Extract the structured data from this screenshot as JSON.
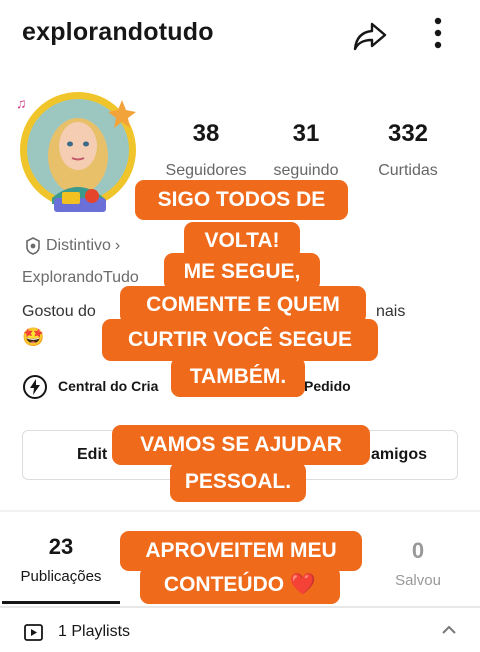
{
  "header": {
    "username": "explorandotudo"
  },
  "stats": [
    {
      "value": "38",
      "label": "Seguidores"
    },
    {
      "value": "31",
      "label": "seguindo"
    },
    {
      "value": "332",
      "label": "Curtidas"
    }
  ],
  "profile": {
    "badge_label": "Distintivo",
    "display_name": "ExplorandoTudo",
    "bio_start": "Gostou do",
    "bio_end": "nais",
    "bio_emoji": "🤩",
    "creator_center": "Central do Cria",
    "request_label": "Pedido"
  },
  "buttons": {
    "edit": "Edit",
    "friends": "amigos"
  },
  "overlay": {
    "line1": "SIGO TODOS DE",
    "line2": "VOLTA!",
    "line3": "ME SEGUE,",
    "line4": "COMENTE E QUEM",
    "line5": "CURTIR VOCÊ SEGUE",
    "line6": "TAMBÉM.",
    "line7": "VAMOS SE AJUDAR",
    "line8": "PESSOAL.",
    "line9": "APROVEITEM MEU",
    "line10": "CONTEÚDO ❤️"
  },
  "tabs": [
    {
      "value": "23",
      "label": "Publicações",
      "active": true
    },
    {
      "value": "0",
      "label": "Salvou",
      "active": false
    }
  ],
  "playlists": {
    "label": "1 Playlists"
  },
  "colors": {
    "accent": "#ef6a1b",
    "text": "#161616",
    "muted": "#6b6b6b"
  }
}
